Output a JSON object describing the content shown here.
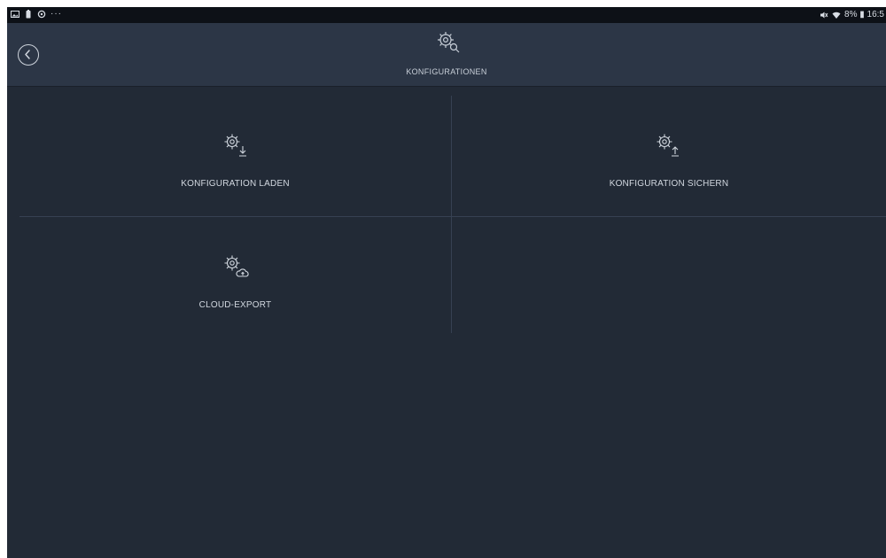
{
  "statusbar": {
    "left_icons": [
      "gallery-icon",
      "battery-saver-icon",
      "settings-icon"
    ],
    "more_indicator": "···",
    "right_icons": [
      "mute-icon",
      "wifi-icon"
    ],
    "right_text": "8% ▮ 16:5"
  },
  "header": {
    "title": "KONFIGURATIONEN",
    "icon": "gear-magnifier-icon",
    "back_icon": "back-arrow-icon"
  },
  "tiles": [
    {
      "label": "KONFIGURATION LADEN",
      "icon": "gear-download-icon"
    },
    {
      "label": "KONFIGURATION SICHERN",
      "icon": "gear-upload-icon"
    },
    {
      "label": "CLOUD-EXPORT",
      "icon": "gear-cloud-icon"
    }
  ],
  "colors": {
    "background": "#222a36",
    "header": "#2c3646",
    "statusbar": "#0d1117",
    "divider": "#364152",
    "text": "#d2d8e0"
  }
}
